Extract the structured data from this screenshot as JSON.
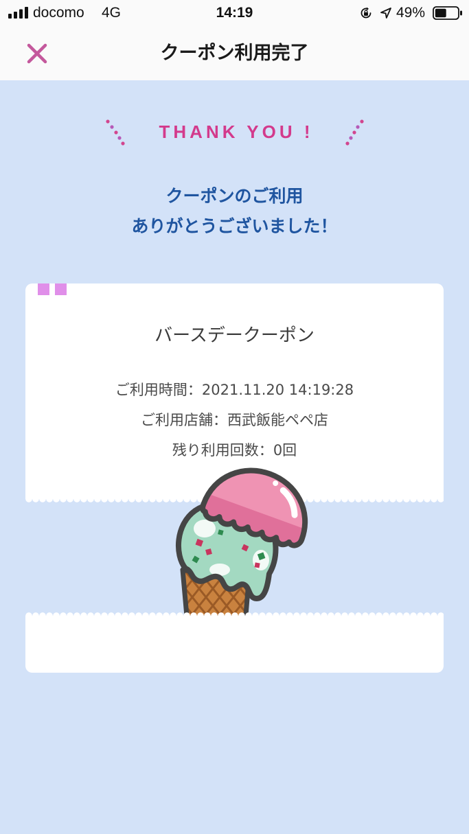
{
  "status_bar": {
    "carrier": "docomo",
    "network": "4G",
    "time": "14:19",
    "battery_percent": "49%",
    "battery_level": 0.49
  },
  "nav": {
    "title": "クーポン利用完了"
  },
  "thanks": {
    "heading": "THANK YOU !",
    "line1": "クーポンのご利用",
    "line2": "ありがとうございました！"
  },
  "coupon": {
    "name": "バースデークーポン",
    "details": [
      {
        "label": "ご利用時間：",
        "value": "2021.11.20 14:19:28"
      },
      {
        "label": "ご利用店舗：",
        "value": "西武飯能ペペ店"
      },
      {
        "label": "残り利用回数：",
        "value": "0回"
      }
    ]
  },
  "colors": {
    "background": "#d3e2f8",
    "accent": "#d33a8c",
    "heading_blue": "#1f55a0",
    "close": "#c4589c",
    "tab": "#e08fe9"
  },
  "icons": {
    "signal": "signal-bars-icon",
    "rotation_lock": "rotation-lock-icon",
    "location": "location-arrow-icon",
    "battery": "battery-icon",
    "close": "close-icon",
    "illustration": "ice-cream-illustration"
  }
}
